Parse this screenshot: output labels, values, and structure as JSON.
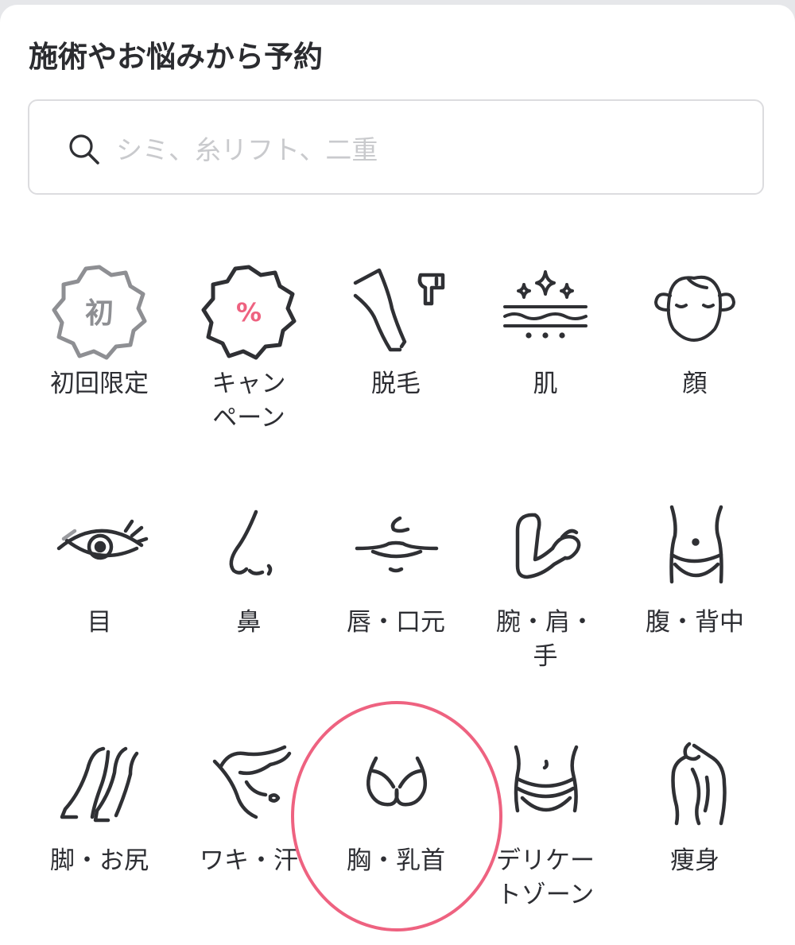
{
  "header": {
    "title": "施術やお悩みから予約"
  },
  "search": {
    "placeholder": "シミ、糸リフト、二重",
    "value": ""
  },
  "colors": {
    "accent": "#ee6280",
    "icon_stroke": "#2f3034",
    "muted_badge": "#8e8f93",
    "placeholder": "#c9cacd"
  },
  "categories": [
    {
      "label": "初回限定",
      "label_line2": "",
      "icon": "first-time-badge-icon",
      "badge_text": "初"
    },
    {
      "label": "キャン",
      "label_line2": "ペーン",
      "icon": "campaign-percent-badge-icon",
      "badge_text": "%"
    },
    {
      "label": "脱毛",
      "label_line2": "",
      "icon": "hair-removal-icon"
    },
    {
      "label": "肌",
      "label_line2": "",
      "icon": "skin-sparkle-icon"
    },
    {
      "label": "顔",
      "label_line2": "",
      "icon": "face-icon"
    },
    {
      "label": "目",
      "label_line2": "",
      "icon": "eye-icon"
    },
    {
      "label": "鼻",
      "label_line2": "",
      "icon": "nose-icon"
    },
    {
      "label": "唇・口元",
      "label_line2": "",
      "icon": "lips-icon"
    },
    {
      "label": "腕・肩・",
      "label_line2": "手",
      "icon": "arm-icon"
    },
    {
      "label": "腹・背中",
      "label_line2": "",
      "icon": "belly-icon"
    },
    {
      "label": "脚・お尻",
      "label_line2": "",
      "icon": "legs-icon"
    },
    {
      "label": "ワキ・汗",
      "label_line2": "",
      "icon": "armpit-icon"
    },
    {
      "label": "胸・乳首",
      "label_line2": "",
      "icon": "chest-icon"
    },
    {
      "label": "デリケー",
      "label_line2": "トゾーン",
      "icon": "delicate-zone-icon"
    },
    {
      "label": "痩身",
      "label_line2": "",
      "icon": "slimming-body-icon"
    }
  ],
  "highlighted_category": "胸・乳首"
}
